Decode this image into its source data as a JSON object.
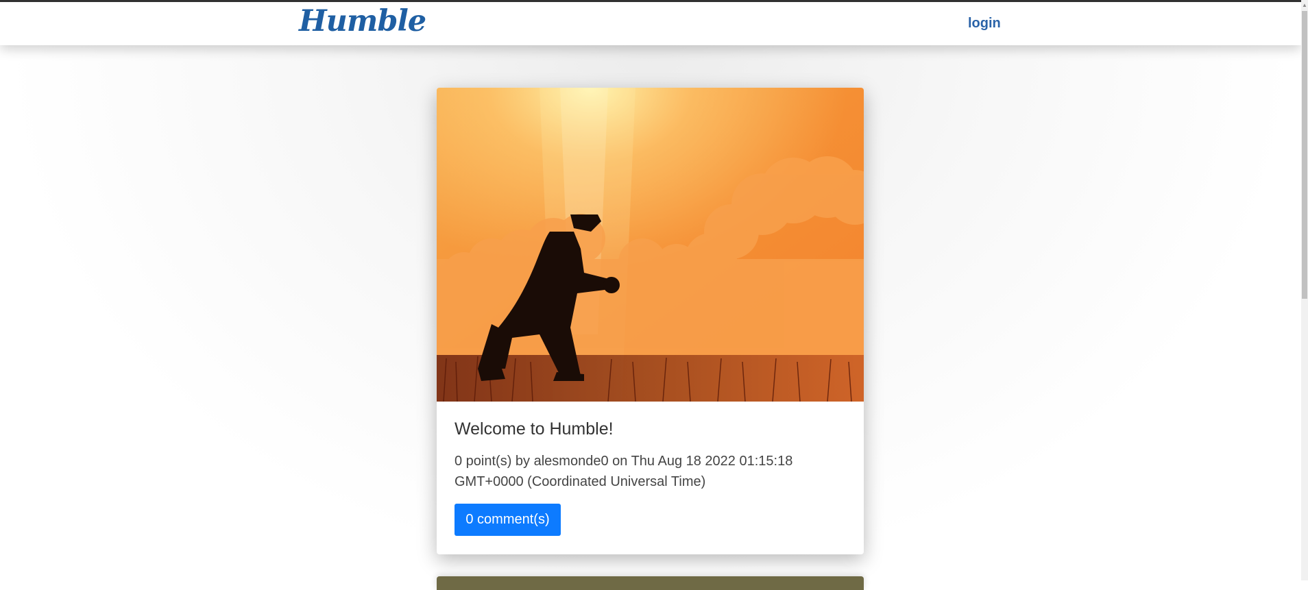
{
  "header": {
    "brand": "Humble",
    "login_label": "login"
  },
  "posts": [
    {
      "title": "Welcome to Humble!",
      "meta": "0 point(s) by alesmonde0 on Thu Aug 18 2022 01:15:18 GMT+0000 (Coordinated Universal Time)",
      "comments_label": "0 comment(s)",
      "image_icon": "praying-man-silhouette"
    }
  ],
  "colors": {
    "brand": "#1f5fa3",
    "link": "#2a63a8",
    "button": "#0d7bff",
    "image_sky": "#f49a3e"
  }
}
